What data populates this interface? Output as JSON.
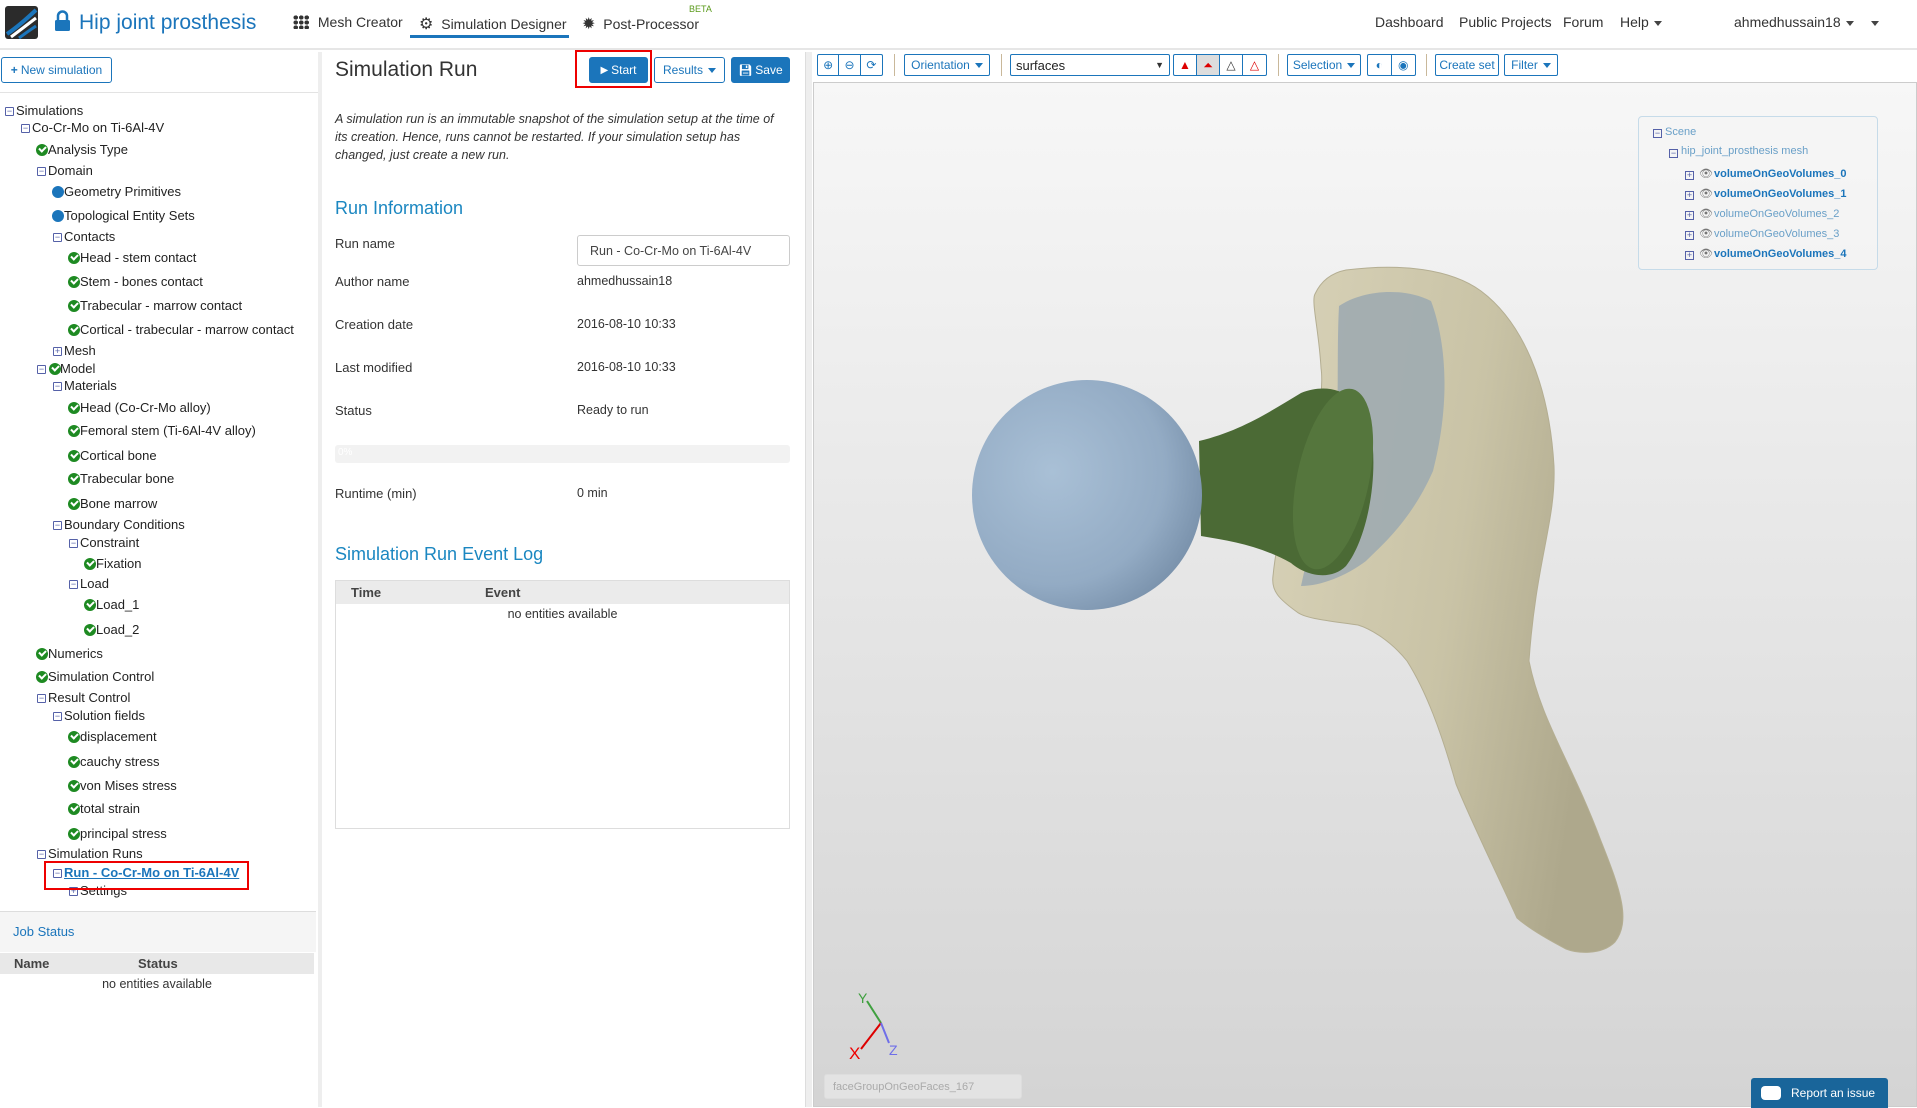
{
  "header": {
    "project_title": "Hip joint prosthesis",
    "tabs": [
      {
        "label": "Mesh Creator",
        "icon": "grid-icon"
      },
      {
        "label": "Simulation Designer",
        "icon": "gears-icon",
        "active": true
      },
      {
        "label": "Post-Processor",
        "icon": "cog-icon",
        "badge": "BETA"
      }
    ],
    "links": [
      "Dashboard",
      "Public Projects",
      "Forum",
      "Help"
    ],
    "user": "ahmedhussain18"
  },
  "sidebar": {
    "new_simulation_label": "New simulation",
    "tree": [
      {
        "label": "Simulations",
        "level": 0,
        "icon": "minus"
      },
      {
        "label": "Co-Cr-Mo on Ti-6Al-4V",
        "level": 1,
        "icon": "minus"
      },
      {
        "label": "Analysis Type",
        "level": 2,
        "icon": "check"
      },
      {
        "label": "Domain",
        "level": 2,
        "icon": "minus"
      },
      {
        "label": "Geometry Primitives",
        "level": 3,
        "icon": "dot"
      },
      {
        "label": "Topological Entity Sets",
        "level": 3,
        "icon": "dot"
      },
      {
        "label": "Contacts",
        "level": 3,
        "icon": "minus"
      },
      {
        "label": "Head - stem contact",
        "level": 4,
        "icon": "check"
      },
      {
        "label": "Stem - bones contact",
        "level": 4,
        "icon": "check"
      },
      {
        "label": "Trabecular - marrow contact",
        "level": 4,
        "icon": "check"
      },
      {
        "label": "Cortical - trabecular - marrow contact",
        "level": 4,
        "icon": "check"
      },
      {
        "label": "Mesh",
        "level": 3,
        "icon": "plus"
      },
      {
        "label": "Model",
        "level": 2,
        "icon": "minus-check"
      },
      {
        "label": "Materials",
        "level": 3,
        "icon": "minus"
      },
      {
        "label": "Head (Co-Cr-Mo alloy)",
        "level": 4,
        "icon": "check"
      },
      {
        "label": "Femoral stem (Ti-6Al-4V alloy)",
        "level": 4,
        "icon": "check"
      },
      {
        "label": "Cortical bone",
        "level": 4,
        "icon": "check"
      },
      {
        "label": "Trabecular bone",
        "level": 4,
        "icon": "check"
      },
      {
        "label": "Bone marrow",
        "level": 4,
        "icon": "check"
      },
      {
        "label": "Boundary Conditions",
        "level": 3,
        "icon": "minus"
      },
      {
        "label": "Constraint",
        "level": 4,
        "icon": "minus"
      },
      {
        "label": "Fixation",
        "level": 5,
        "icon": "check"
      },
      {
        "label": "Load",
        "level": 4,
        "icon": "minus"
      },
      {
        "label": "Load_1",
        "level": 5,
        "icon": "check"
      },
      {
        "label": "Load_2",
        "level": 5,
        "icon": "check"
      },
      {
        "label": "Numerics",
        "level": 2,
        "icon": "check"
      },
      {
        "label": "Simulation Control",
        "level": 2,
        "icon": "check"
      },
      {
        "label": "Result Control",
        "level": 2,
        "icon": "minus"
      },
      {
        "label": "Solution fields",
        "level": 3,
        "icon": "minus"
      },
      {
        "label": "displacement",
        "level": 4,
        "icon": "check"
      },
      {
        "label": "cauchy stress",
        "level": 4,
        "icon": "check"
      },
      {
        "label": "von Mises stress",
        "level": 4,
        "icon": "check"
      },
      {
        "label": "total strain",
        "level": 4,
        "icon": "check"
      },
      {
        "label": "principal stress",
        "level": 4,
        "icon": "check"
      },
      {
        "label": "Simulation Runs",
        "level": 2,
        "icon": "minus"
      },
      {
        "label": "Run - Co-Cr-Mo on Ti-6Al-4V",
        "level": 3,
        "icon": "minus",
        "selected": true
      },
      {
        "label": "Settings",
        "level": 4,
        "icon": "plus"
      }
    ],
    "job_status": {
      "title": "Job Status",
      "columns": [
        "Name",
        "Status"
      ],
      "empty": "no entities available"
    }
  },
  "run": {
    "title": "Simulation Run",
    "start_label": "Start",
    "results_label": "Results",
    "save_label": "Save",
    "description": "A simulation run is an immutable snapshot of the simulation setup at the time of its creation. Hence, runs cannot be restarted. If your simulation setup has changed, just create a new run.",
    "info_heading": "Run Information",
    "fields": {
      "run_name_label": "Run name",
      "run_name_value": "Run - Co-Cr-Mo on Ti-6Al-4V",
      "author_label": "Author name",
      "author_value": "ahmedhussain18",
      "creation_label": "Creation date",
      "creation_value": "2016-08-10 10:33",
      "modified_label": "Last modified",
      "modified_value": "2016-08-10 10:33",
      "status_label": "Status",
      "status_value": "Ready to run",
      "progress_text": "0%",
      "progress_percent": 0,
      "runtime_label": "Runtime (min)",
      "runtime_value": "0 min"
    },
    "log_heading": "Simulation Run Event Log",
    "log_columns": [
      "Time",
      "Event"
    ],
    "log_empty": "no entities available"
  },
  "viewer": {
    "toolbar": {
      "orientation_label": "Orientation",
      "render_mode": "surfaces",
      "selection_label": "Selection",
      "create_set_label": "Create set",
      "filter_label": "Filter"
    },
    "scene": {
      "root": "Scene",
      "mesh": "hip_joint_prosthesis mesh",
      "volumes": [
        {
          "label": "volumeOnGeoVolumes_0",
          "visible": true
        },
        {
          "label": "volumeOnGeoVolumes_1",
          "visible": true
        },
        {
          "label": "volumeOnGeoVolumes_2",
          "visible": false
        },
        {
          "label": "volumeOnGeoVolumes_3",
          "visible": false
        },
        {
          "label": "volumeOnGeoVolumes_4",
          "visible": true
        }
      ]
    },
    "axes": {
      "x": "X",
      "y": "Y",
      "z": "Z"
    },
    "hover_field": "faceGroupOnGeoFaces_167",
    "report_label": "Report an issue",
    "colors": {
      "bone": "#cdc7ab",
      "head": "#9ab2cb",
      "stem": "#4b6a35",
      "accent": "#1b75bb"
    }
  }
}
